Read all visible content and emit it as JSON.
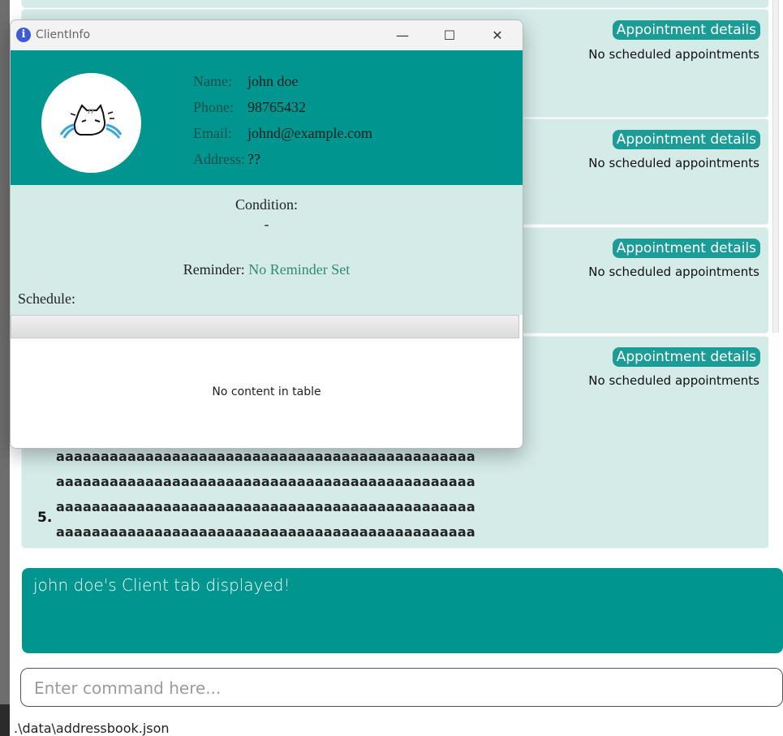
{
  "list": {
    "cards": [
      {
        "button": "Appointment details",
        "status": "No scheduled appointments"
      },
      {
        "button": "Appointment details",
        "status": "No scheduled appointments"
      },
      {
        "button": "Appointment details",
        "status": "No scheduled appointments"
      },
      {
        "button": "Appointment details",
        "status": "No scheduled appointments"
      }
    ],
    "last_card": {
      "index": "5.",
      "name_lines": [
        "aaaaaaaaaaaaaaaaaaaaaaaaaaaaaaaaaaaaaaaaaaaaaaa",
        "aaaaaaaaaaaaaaaaaaaaaaaaaaaaaaaaaaaaaaaaaaaaaaa",
        "aaaaaaaaaaaaaaaaaaaaaaaaaaaaaaaaaaaaaaaaaaaaaaa",
        "aaaaaaaaaaaaaaaaaaaaaaaaaaaaaaaaaaaaaaaaaaaaaaa"
      ]
    }
  },
  "result": {
    "text": "john doe's Client tab displayed!"
  },
  "command": {
    "placeholder": "Enter command here..."
  },
  "status_bar": {
    "path": ".\\data\\addressbook.json"
  },
  "window": {
    "title": "ClientInfo",
    "icon": "info-icon",
    "controls": {
      "minimize": "—",
      "maximize": "☐",
      "close": "✕"
    },
    "client": {
      "name_label": "Name:",
      "name": "john doe",
      "phone_label": "Phone:",
      "phone": "98765432",
      "email_label": "Email:",
      "email": "johnd@example.com",
      "address_label": "Address:",
      "address": "??"
    },
    "condition_label": "Condition:",
    "condition_value": "-",
    "reminder_label": "Reminder:",
    "reminder_value": "No Reminder Set",
    "schedule_label": "Schedule:",
    "table_empty": "No content in table"
  },
  "colors": {
    "teal": "#00968f",
    "light_teal": "#d4ebe7",
    "button_teal": "#1c9c96",
    "reminder_green": "#2e8c6e"
  }
}
